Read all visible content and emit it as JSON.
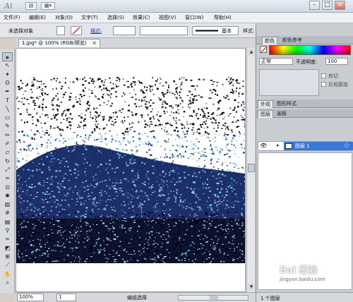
{
  "app": {
    "logo": "Ai"
  },
  "window_controls": {
    "minimize": "–",
    "maximize": "□",
    "close": "×"
  },
  "menu": [
    "文件(F)",
    "编辑(E)",
    "对象(O)",
    "文字(T)",
    "选择(S)",
    "效果(C)",
    "视图(V)",
    "窗口(W)",
    "帮助(H)"
  ],
  "control_bar": {
    "selection_status": "未选择对象",
    "stroke_label": "描边:",
    "stroke_profile": "基本",
    "style_label": "样式:"
  },
  "document": {
    "tab_title": "1.jpg* @ 100% (RGB/预览)",
    "close_icon": "×"
  },
  "toolbox_icons": [
    "selection-tool",
    "direct-selection-tool",
    "magic-wand-tool",
    "lasso-tool",
    "pen-tool",
    "type-tool",
    "line-tool",
    "rectangle-tool",
    "paintbrush-tool",
    "pencil-tool",
    "blob-brush-tool",
    "eraser-tool",
    "rotate-tool",
    "scale-tool",
    "warp-tool",
    "free-transform-tool",
    "symbol-sprayer-tool",
    "column-graph-tool",
    "mesh-tool",
    "gradient-tool",
    "eyedropper-tool",
    "blend-tool",
    "live-paint-tool",
    "artboard-tool",
    "slice-tool",
    "hand-tool",
    "zoom-tool"
  ],
  "status_bar": {
    "zoom": "100%",
    "artboard": "1",
    "mode": "编组选择"
  },
  "color_panel": {
    "tabs": [
      "颜色",
      "颜色参考"
    ],
    "blend_mode": "正常",
    "opacity_label": "不透明度:",
    "opacity_value": "100",
    "clip_label": "剪切",
    "invert_label": "反相蒙版"
  },
  "appearance_panel": {
    "tabs": [
      "外观",
      "图形样式"
    ]
  },
  "layers_panel": {
    "tabs": [
      "图层",
      "画板"
    ],
    "layer_name": "图层 1",
    "footer": "1 个图层"
  },
  "watermark": {
    "brand": "Bai 经验",
    "url": "jingyan.baidu.com"
  },
  "colors": {
    "selection_blue": "#3a78d8",
    "photo_teal": "#5bb7c9",
    "photo_navy": "#1d2f6a"
  }
}
